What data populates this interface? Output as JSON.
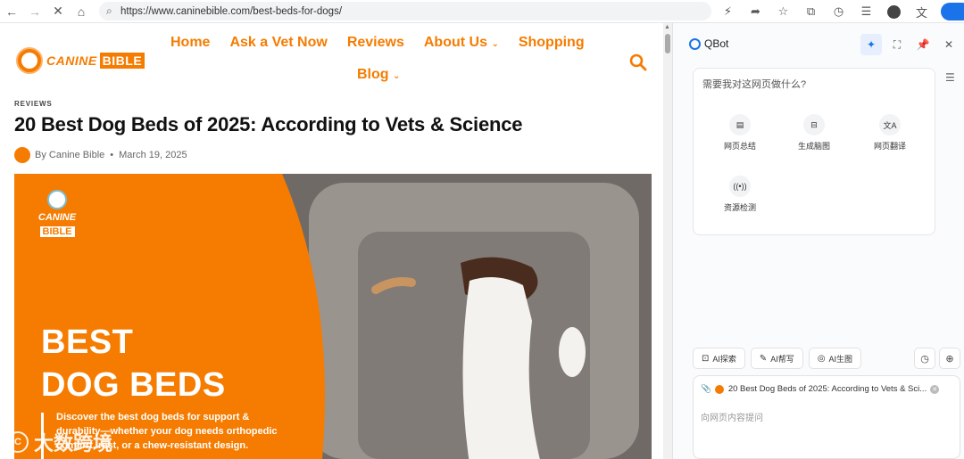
{
  "browser": {
    "url": "https://www.caninebible.com/best-beds-for-dogs/",
    "back_icon": "back-arrow-icon",
    "forward_icon": "forward-arrow-icon"
  },
  "site": {
    "logo_word1": "CANINE",
    "logo_word2": "BIBLE",
    "nav": [
      "Home",
      "Ask a Vet Now",
      "Reviews",
      "About Us",
      "Shopping",
      "Blog"
    ],
    "accent": "#f57c00"
  },
  "article": {
    "eyebrow": "REVIEWS",
    "title": "20 Best Dog Beds of 2025: According to Vets & Science",
    "author": "By Canine Bible",
    "date": "March 19, 2025"
  },
  "hero": {
    "logo_word1": "CANINE",
    "logo_word2": "BIBLE",
    "headline1": "BEST",
    "headline2": "DOG BEDS",
    "description": "Discover the best dog beds for support & durability—whether your dog needs orthopedic comfort, rest, or a chew-resistant design."
  },
  "watermark": "大数跨境",
  "qbot": {
    "title": "QBot",
    "prompt": "需要我对这网页做什么?",
    "tools": [
      "网页总结",
      "生成脑图",
      "网页翻译",
      "资源检测"
    ],
    "chips": [
      "AI探索",
      "AI帮写",
      "AI生图"
    ],
    "attachment": "20 Best Dog Beds of 2025: According to Vets & Sci...",
    "input_placeholder": "向网页内容提问"
  }
}
